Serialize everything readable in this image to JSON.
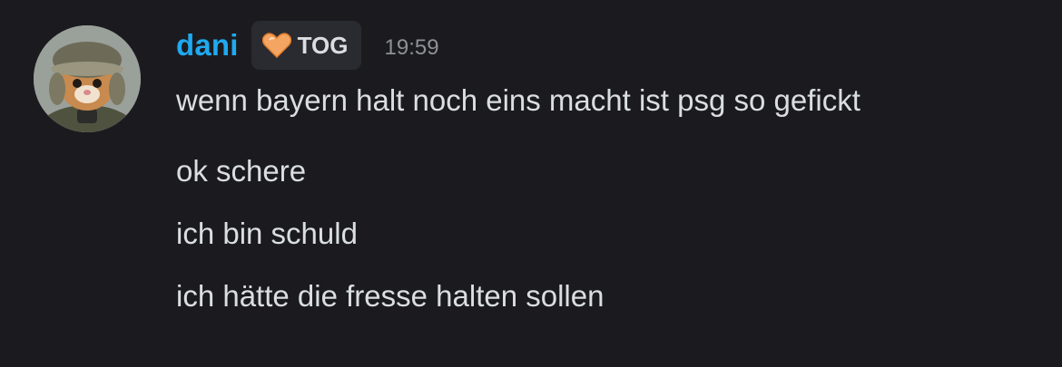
{
  "message": {
    "author": {
      "name": "dani",
      "name_color": "#1fa9f0",
      "avatar": "cat-in-winter-hat-avatar",
      "clan_tag": {
        "icon": "orange-heart-icon",
        "text": "TOG"
      }
    },
    "timestamp": "19:59",
    "lines": [
      "wenn bayern halt noch eins macht ist psg so gefickt",
      "ok schere",
      "ich bin schuld",
      "ich hätte die fresse halten sollen"
    ]
  },
  "colors": {
    "background": "#1b1b1f",
    "message_text": "#dbdee1",
    "timestamp": "#8e9097",
    "tag_background": "#2a2b30"
  }
}
